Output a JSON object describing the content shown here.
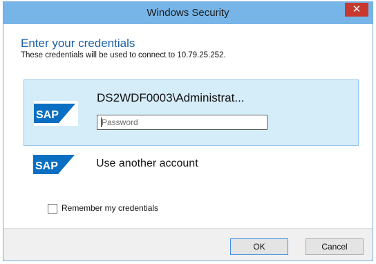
{
  "window": {
    "title": "Windows Security",
    "close_glyph": "✕"
  },
  "dialog": {
    "heading": "Enter your credentials",
    "subtext": "These credentials will be used to connect to 10.79.25.252."
  },
  "accounts": {
    "selected": {
      "logo": "sap-logo",
      "name": "DS2WDF0003\\Administrat...",
      "password_placeholder": "Password",
      "password_value": ""
    },
    "other": {
      "logo": "sap-logo",
      "label": "Use another account"
    }
  },
  "options": {
    "remember_label": "Remember my credentials",
    "remember_checked": false
  },
  "buttons": {
    "ok_label": "OK",
    "cancel_label": "Cancel"
  },
  "colors": {
    "titlebar": "#77b5e8",
    "close_button": "#c7392f",
    "heading": "#1a5fa8",
    "selected_tile": "#d5ecf9",
    "sap_blue": "#0a6fc2"
  }
}
